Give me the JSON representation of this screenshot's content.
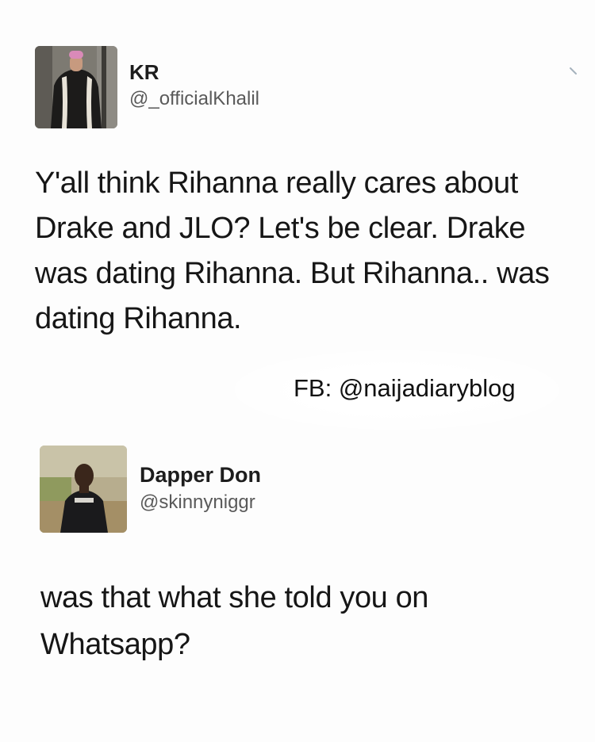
{
  "tweets": [
    {
      "name": "KR",
      "handle": "@_officialKhalil",
      "text": "Y'all think Rihanna really cares about Drake and JLO? Let's be clear. Drake was dating Rihanna. But Rihanna.. was dating Rihanna."
    },
    {
      "name": "Dapper Don",
      "handle": "@skinnyniggr",
      "text": "was that what she told you on Whatsapp?"
    }
  ],
  "watermark": "FB: @naijadiaryblog",
  "icons": {
    "avatar_1": "user-avatar-photo",
    "avatar_2": "user-avatar-photo",
    "menu": "chevron-down-icon"
  },
  "colors": {
    "background": "#fdfdfd",
    "text": "#161616",
    "handle": "#5a5a5a"
  }
}
